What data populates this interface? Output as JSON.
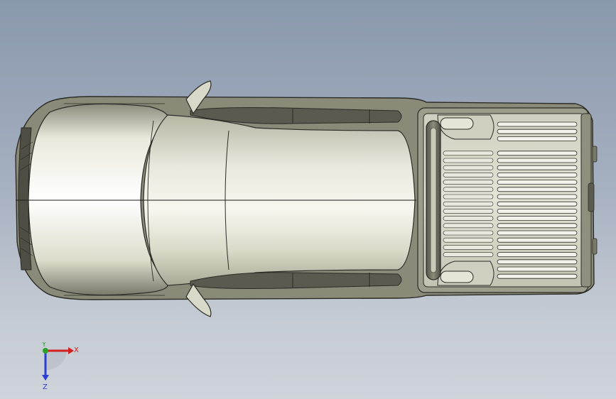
{
  "viewport": {
    "view": "top",
    "model": "pickup-truck",
    "colors": {
      "body_light": "#f4f4ea",
      "body_mid": "#cfcfbe",
      "body_dark": "#6f6f62",
      "outline": "#2b2b25",
      "glass": "#505046"
    }
  },
  "triad": {
    "x_label": "X",
    "y_label": "Y",
    "z_label": "Z",
    "x_color": "#d21f1f",
    "y_color": "#2ba02b",
    "z_color": "#2a3fd0"
  }
}
